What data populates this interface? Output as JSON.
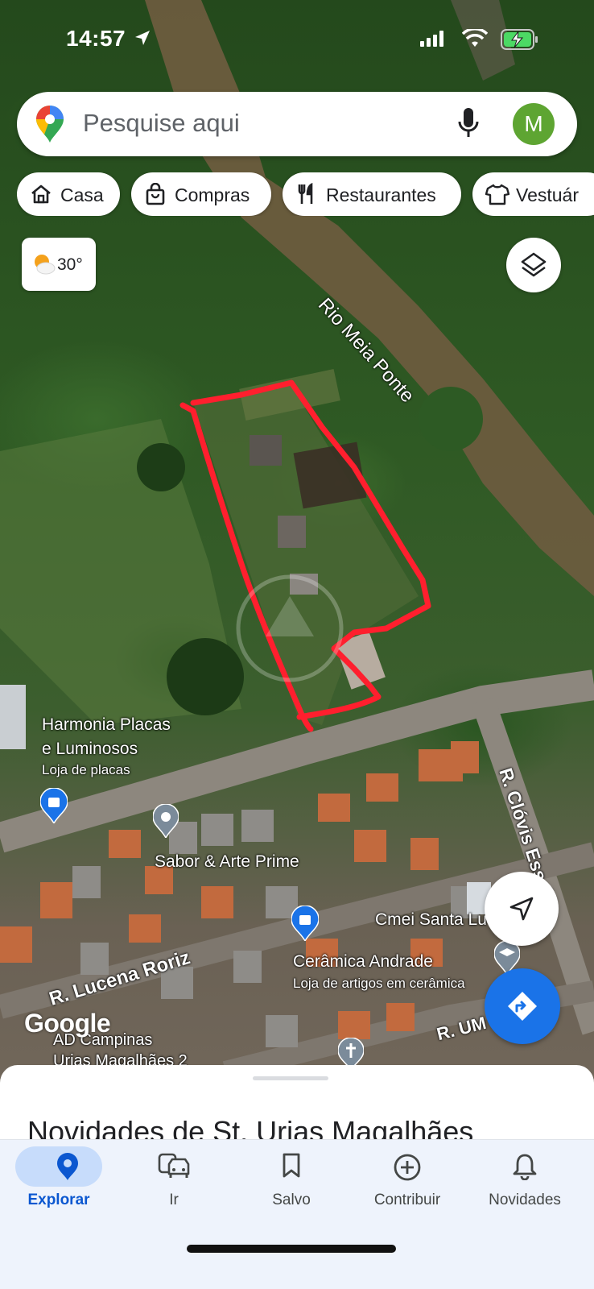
{
  "status_bar": {
    "time": "14:57"
  },
  "search": {
    "placeholder": "Pesquise aqui",
    "avatar_letter": "M"
  },
  "chips": [
    {
      "label": "Casa",
      "icon": "home-icon"
    },
    {
      "label": "Compras",
      "icon": "shopping-bag-icon"
    },
    {
      "label": "Restaurantes",
      "icon": "restaurant-icon"
    },
    {
      "label": "Vestuár",
      "icon": "shirt-icon"
    }
  ],
  "weather": {
    "temperature": "30°"
  },
  "map_labels": {
    "river": "Rio Meia Ponte",
    "harmonia_name_line1": "Harmonia Placas",
    "harmonia_name_line2": "e Luminosos",
    "harmonia_category": "Loja de placas",
    "sabor": "Sabor & Arte Prime",
    "clovis_street": "R. Clóvis Esselim",
    "cmei": "Cmei Santa Lu",
    "lucena_street": "R. Lucena Roriz",
    "ceramica_name": "Cerâmica Andrade",
    "ceramica_category": "Loja de artigos em cerâmica",
    "um_street": "R. UM",
    "campinas_line1": "AD Campinas",
    "campinas_line2": "Urias Magalhães 2",
    "google": "Google"
  },
  "sheet": {
    "title": "Novidades de St. Urias Magalhães"
  },
  "bottom_nav": [
    {
      "label": "Explorar",
      "icon": "explore-pin-icon",
      "active": true
    },
    {
      "label": "Ir",
      "icon": "commute-car-icon",
      "active": false
    },
    {
      "label": "Salvo",
      "icon": "bookmark-icon",
      "active": false
    },
    {
      "label": "Contribuir",
      "icon": "add-circle-icon",
      "active": false
    },
    {
      "label": "Novidades",
      "icon": "bell-icon",
      "active": false
    }
  ],
  "colors": {
    "accent": "#1a73e8",
    "annotation": "#ff1f2e",
    "avatar": "#5ea532",
    "nav_active": "#0b57d0"
  }
}
